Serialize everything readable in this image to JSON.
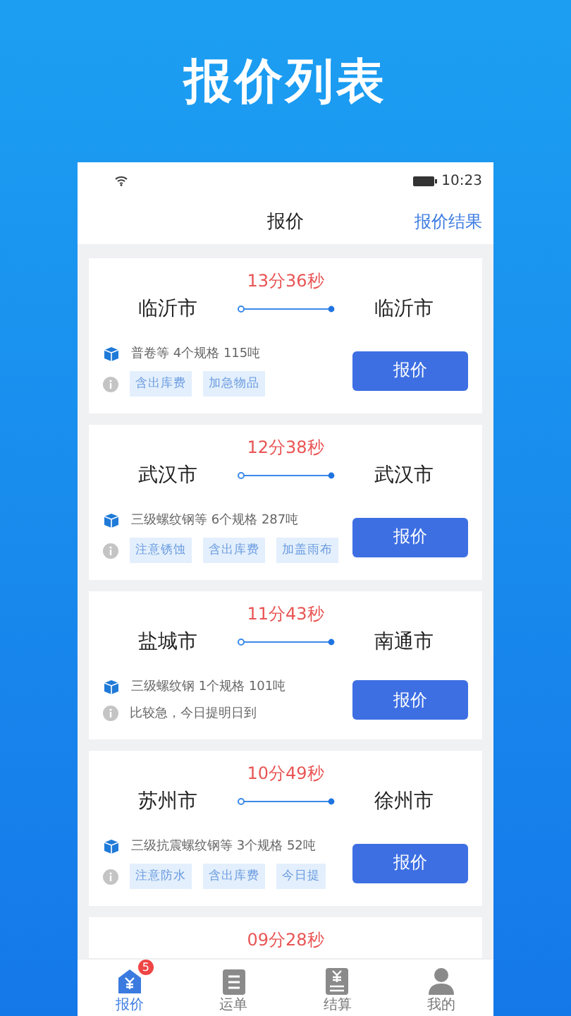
{
  "banner_title": "报价列表",
  "status_bar": {
    "time": "10:23"
  },
  "header": {
    "title": "报价",
    "action": "报价结果"
  },
  "cards": [
    {
      "timer": "13分36秒",
      "from": "临沂市",
      "to": "临沂市",
      "cargo": "普卷等 4个规格 115吨",
      "kind": "tags",
      "tags": [
        "含出库费",
        "加急物品"
      ],
      "button": "报价"
    },
    {
      "timer": "12分38秒",
      "from": "武汉市",
      "to": "武汉市",
      "cargo": "三级螺纹钢等 6个规格 287吨",
      "kind": "tags",
      "tags": [
        "注意锈蚀",
        "含出库费",
        "加盖雨布"
      ],
      "button": "报价"
    },
    {
      "timer": "11分43秒",
      "from": "盐城市",
      "to": "南通市",
      "cargo": "三级螺纹钢 1个规格 101吨",
      "kind": "note",
      "note": "比较急，今日提明日到",
      "button": "报价"
    },
    {
      "timer": "10分49秒",
      "from": "苏州市",
      "to": "徐州市",
      "cargo": "三级抗震螺纹钢等 3个规格 52吨",
      "kind": "tags",
      "tags": [
        "注意防水",
        "含出库费",
        "今日提"
      ],
      "button": "报价"
    },
    {
      "timer": "09分28秒",
      "kind": "partial"
    }
  ],
  "tabs": [
    {
      "label": "报价",
      "selected": true,
      "badge": "5"
    },
    {
      "label": "运单",
      "selected": false
    },
    {
      "label": "结算",
      "selected": false
    },
    {
      "label": "我的",
      "selected": false
    }
  ]
}
